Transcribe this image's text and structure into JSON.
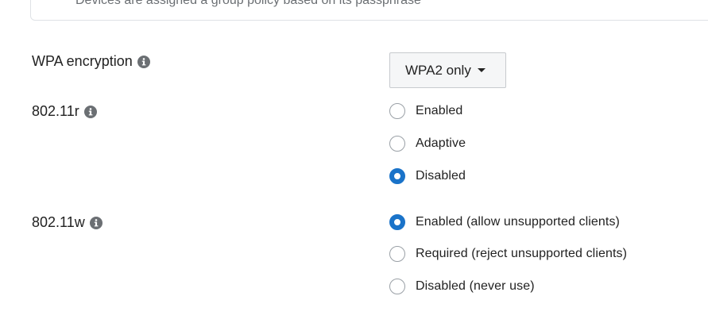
{
  "group_policy_note": "Devices are assigned a group policy based on its passphrase",
  "wpa": {
    "label": "WPA encryption",
    "dropdown_value": "WPA2 only"
  },
  "r80211": {
    "label": "802.11r",
    "options": [
      {
        "label": "Enabled",
        "selected": false
      },
      {
        "label": "Adaptive",
        "selected": false
      },
      {
        "label": "Disabled",
        "selected": true
      }
    ]
  },
  "w80211": {
    "label": "802.11w",
    "options": [
      {
        "label": "Enabled (allow unsupported clients)",
        "selected": true
      },
      {
        "label": "Required (reject unsupported clients)",
        "selected": false
      },
      {
        "label": "Disabled (never use)",
        "selected": false
      }
    ]
  },
  "colors": {
    "accent": "#1a73c9",
    "info_icon": "#6b6f73"
  }
}
